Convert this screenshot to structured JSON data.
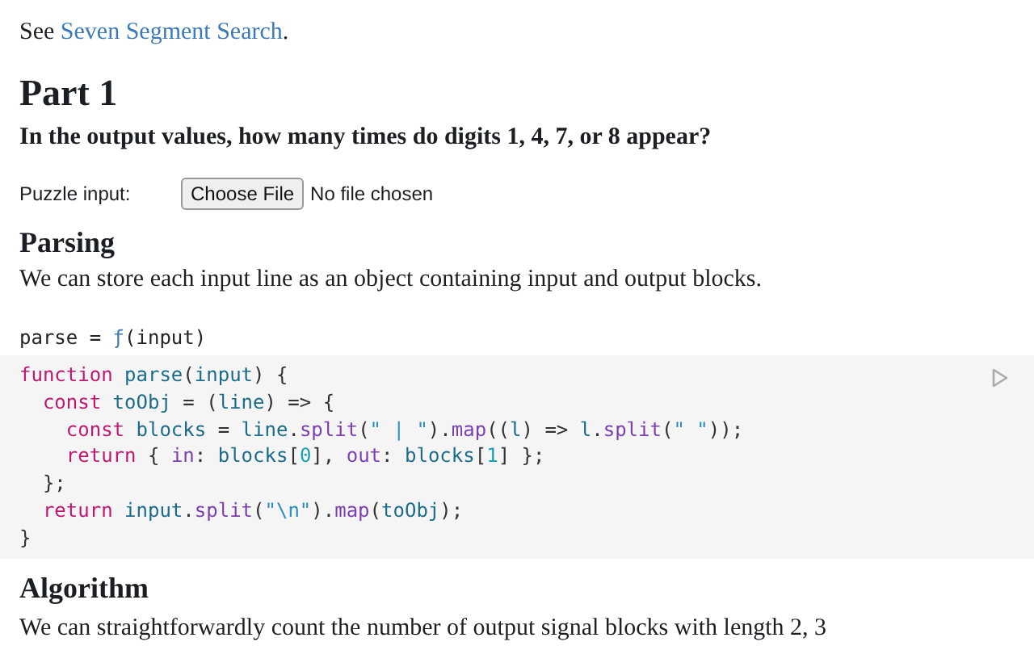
{
  "intro": {
    "before": "See ",
    "link": "Seven Segment Search",
    "after": "."
  },
  "part_title": "Part 1",
  "question": "In the output values, how many times do digits 1, 4, 7, or 8 appear?",
  "file_input": {
    "label": "Puzzle input:",
    "button": "Choose File",
    "status": "No file chosen"
  },
  "parsing": {
    "title": "Parsing",
    "text": "We can store each input line as an object containing input and output blocks."
  },
  "cell": {
    "name": "parse = ",
    "fn": "ƒ",
    "args": "(input)",
    "code": [
      [
        {
          "t": "function ",
          "color": "#c0166f"
        },
        {
          "t": "parse",
          "color": "#1b6b8a"
        },
        {
          "t": "(",
          "color": "#333333"
        },
        {
          "t": "input",
          "color": "#1b6b8a"
        },
        {
          "t": ") {",
          "color": "#333333"
        }
      ],
      [
        {
          "t": "  const ",
          "color": "#c0166f"
        },
        {
          "t": "toObj",
          "color": "#1b6b8a"
        },
        {
          "t": " = (",
          "color": "#333333"
        },
        {
          "t": "line",
          "color": "#1b6b8a"
        },
        {
          "t": ") => {",
          "color": "#333333"
        }
      ],
      [
        {
          "t": "    const ",
          "color": "#c0166f"
        },
        {
          "t": "blocks",
          "color": "#1b6b8a"
        },
        {
          "t": " = ",
          "color": "#333333"
        },
        {
          "t": "line",
          "color": "#1b6b8a"
        },
        {
          "t": ".",
          "color": "#333333"
        },
        {
          "t": "split",
          "color": "#7b3fb0"
        },
        {
          "t": "(",
          "color": "#333333"
        },
        {
          "t": "\" | \"",
          "color": "#2a8fbf"
        },
        {
          "t": ").",
          "color": "#333333"
        },
        {
          "t": "map",
          "color": "#7b3fb0"
        },
        {
          "t": "((",
          "color": "#333333"
        },
        {
          "t": "l",
          "color": "#1b6b8a"
        },
        {
          "t": ") => ",
          "color": "#333333"
        },
        {
          "t": "l",
          "color": "#1b6b8a"
        },
        {
          "t": ".",
          "color": "#333333"
        },
        {
          "t": "split",
          "color": "#7b3fb0"
        },
        {
          "t": "(",
          "color": "#333333"
        },
        {
          "t": "\" \"",
          "color": "#2a8fbf"
        },
        {
          "t": "));",
          "color": "#333333"
        }
      ],
      [
        {
          "t": "    return",
          "color": "#c0166f"
        },
        {
          "t": " { ",
          "color": "#333333"
        },
        {
          "t": "in",
          "color": "#7b3fb0"
        },
        {
          "t": ": ",
          "color": "#333333"
        },
        {
          "t": "blocks",
          "color": "#1b6b8a"
        },
        {
          "t": "[",
          "color": "#333333"
        },
        {
          "t": "0",
          "color": "#1aa0b0"
        },
        {
          "t": "], ",
          "color": "#333333"
        },
        {
          "t": "out",
          "color": "#7b3fb0"
        },
        {
          "t": ": ",
          "color": "#333333"
        },
        {
          "t": "blocks",
          "color": "#1b6b8a"
        },
        {
          "t": "[",
          "color": "#333333"
        },
        {
          "t": "1",
          "color": "#1aa0b0"
        },
        {
          "t": "] };",
          "color": "#333333"
        }
      ],
      [
        {
          "t": "  };",
          "color": "#333333"
        }
      ],
      [
        {
          "t": "  return ",
          "color": "#c0166f"
        },
        {
          "t": "input",
          "color": "#1b6b8a"
        },
        {
          "t": ".",
          "color": "#333333"
        },
        {
          "t": "split",
          "color": "#7b3fb0"
        },
        {
          "t": "(",
          "color": "#333333"
        },
        {
          "t": "\"\\n\"",
          "color": "#2a8fbf"
        },
        {
          "t": ").",
          "color": "#333333"
        },
        {
          "t": "map",
          "color": "#7b3fb0"
        },
        {
          "t": "(",
          "color": "#333333"
        },
        {
          "t": "toObj",
          "color": "#1b6b8a"
        },
        {
          "t": ");",
          "color": "#333333"
        }
      ],
      [
        {
          "t": "}",
          "color": "#333333"
        }
      ]
    ]
  },
  "algorithm": {
    "title": "Algorithm",
    "text": "We can straightforwardly count the number of output signal blocks with length 2, 3"
  }
}
